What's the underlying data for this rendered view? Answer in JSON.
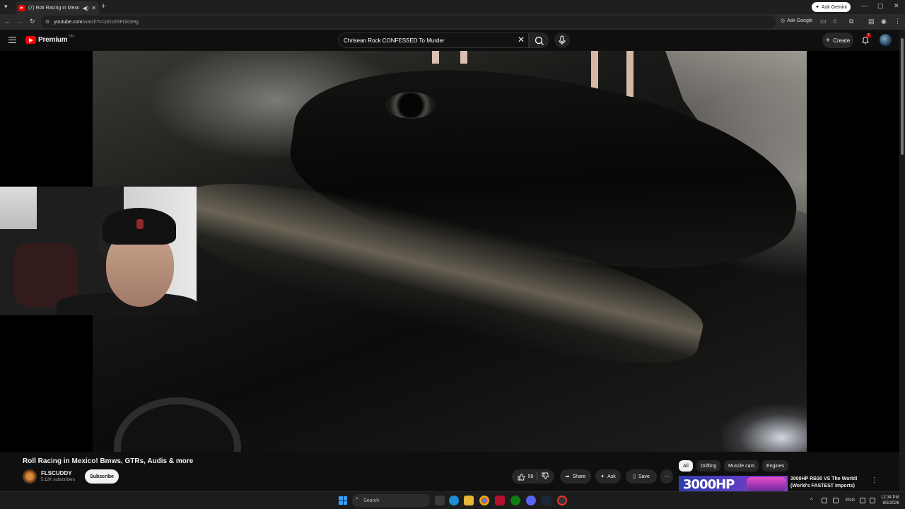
{
  "browser": {
    "tab_title": "(7) Roll Racing in Mexico! B",
    "url_main": "youtube.com",
    "url_rest": "/watch?v=pGs3SFDkSHg",
    "ask_gemini": "Ask Gemini",
    "ask_google": "Ask Google"
  },
  "header": {
    "logo_word": "Premium",
    "region": "TH",
    "search_value": "Chrisean Rock CONFESSED To Murder",
    "create_label": "Create",
    "notification_count": "7"
  },
  "video": {
    "title": "Roll Racing in Mexico! Bmws, GTRs, Audis & more",
    "channel_name": "FLSCUDDY",
    "subscribers": "5.12K subscribers",
    "subscribe_label": "Subscribe",
    "like_count": "59",
    "share_label": "Share",
    "ask_label": "Ask",
    "save_label": "Save"
  },
  "chips": [
    "All",
    "Drifting",
    "Muscle cars",
    "Engines"
  ],
  "recommendation": {
    "thumb_text": "3000HP",
    "title": "3000HP RB30 VS The World! (World's FASTEST Imports)"
  },
  "taskbar": {
    "search_placeholder": "Search",
    "language": "ENG",
    "time": "12:34 PM",
    "date": "8/5/2026"
  },
  "colors": {
    "yt_red": "#ff0000",
    "background": "#0f0f0f",
    "chip_bg": "#272727"
  }
}
